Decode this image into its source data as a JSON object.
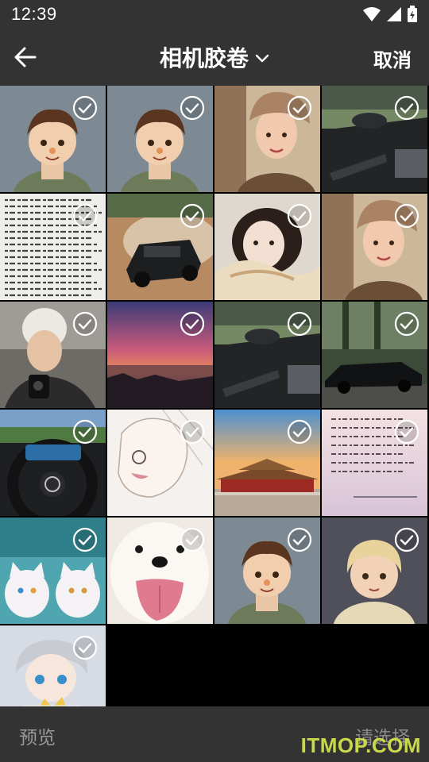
{
  "status_bar": {
    "time": "12:39"
  },
  "app_bar": {
    "title": "相机胶卷",
    "cancel": "取消"
  },
  "photos": [
    {
      "icon": "cartoon-boy-photo",
      "selected": true
    },
    {
      "icon": "cartoon-boy-photo",
      "selected": true
    },
    {
      "icon": "girl-in-hat-photo",
      "selected": true
    },
    {
      "icon": "car-interior-photo",
      "selected": true
    },
    {
      "icon": "handwritten-document-photo",
      "selected": true
    },
    {
      "icon": "offroad-car-photo",
      "selected": true
    },
    {
      "icon": "girl-lying-photo",
      "selected": true
    },
    {
      "icon": "girl-in-hat-photo",
      "selected": true
    },
    {
      "icon": "young-man-photo",
      "selected": true
    },
    {
      "icon": "sunset-sea-photo",
      "selected": true
    },
    {
      "icon": "car-interior-photo",
      "selected": true
    },
    {
      "icon": "black-car-photo",
      "selected": true
    },
    {
      "icon": "steering-wheel-photo",
      "selected": true
    },
    {
      "icon": "anime-sketch-photo",
      "selected": true
    },
    {
      "icon": "forbidden-city-photo",
      "selected": true
    },
    {
      "icon": "handwritten-note-photo",
      "selected": true
    },
    {
      "icon": "white-cats-photo",
      "selected": true
    },
    {
      "icon": "white-dog-photo",
      "selected": true
    },
    {
      "icon": "cartoon-boy-photo",
      "selected": true
    },
    {
      "icon": "cartoon-child-photo",
      "selected": true
    },
    {
      "icon": "anime-character-photo",
      "selected": true
    }
  ],
  "bottom_bar": {
    "preview": "预览",
    "select": "请选择"
  },
  "watermark": "ITMOP.COM",
  "colors": {
    "bar_bg": "#333334",
    "grid_bg": "#000000",
    "muted_text": "#9a9a9a",
    "watermark": "#c9d94a"
  }
}
